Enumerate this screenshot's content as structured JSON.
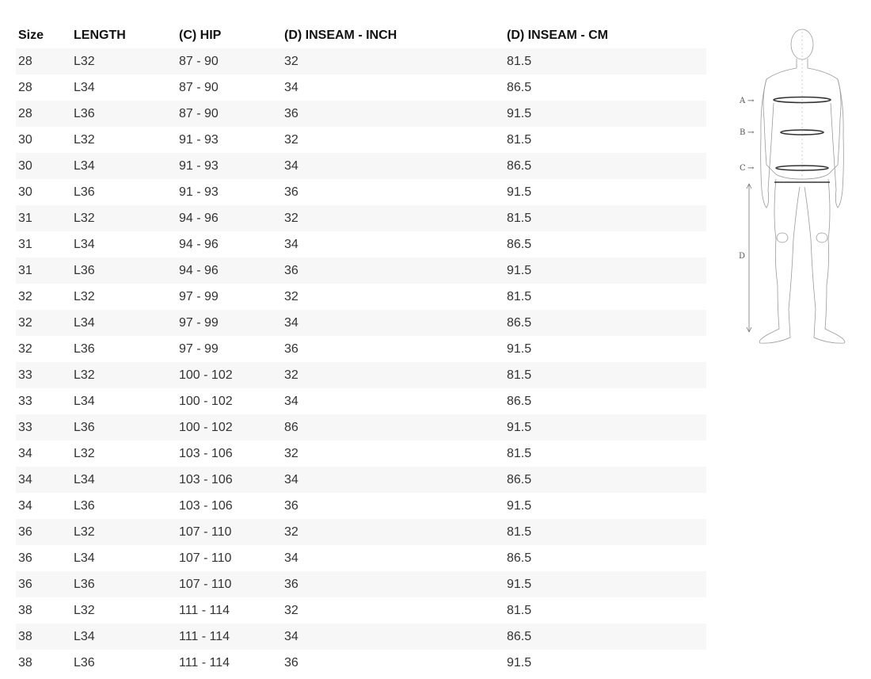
{
  "table": {
    "headers": [
      "Size",
      "LENGTH",
      "(C) HIP",
      "(D) INSEAM - INCH",
      "(D) INSEAM - CM"
    ],
    "rows": [
      [
        "28",
        "L32",
        "87 - 90",
        "32",
        "81.5"
      ],
      [
        "28",
        "L34",
        "87 - 90",
        "34",
        "86.5"
      ],
      [
        "28",
        "L36",
        "87 - 90",
        "36",
        "91.5"
      ],
      [
        "30",
        "L32",
        "91 - 93",
        "32",
        "81.5"
      ],
      [
        "30",
        "L34",
        "91 - 93",
        "34",
        "86.5"
      ],
      [
        "30",
        "L36",
        "91 - 93",
        "36",
        "91.5"
      ],
      [
        "31",
        "L32",
        "94 - 96",
        "32",
        "81.5"
      ],
      [
        "31",
        "L34",
        "94 - 96",
        "34",
        "86.5"
      ],
      [
        "31",
        "L36",
        "94 - 96",
        "36",
        "91.5"
      ],
      [
        "32",
        "L32",
        "97 - 99",
        "32",
        "81.5"
      ],
      [
        "32",
        "L34",
        "97 - 99",
        "34",
        "86.5"
      ],
      [
        "32",
        "L36",
        "97 - 99",
        "36",
        "91.5"
      ],
      [
        "33",
        "L32",
        "100 - 102",
        "32",
        "81.5"
      ],
      [
        "33",
        "L34",
        "100 - 102",
        "34",
        "86.5"
      ],
      [
        "33",
        "L36",
        "100 - 102",
        "86",
        "91.5"
      ],
      [
        "34",
        "L32",
        "103 - 106",
        "32",
        "81.5"
      ],
      [
        "34",
        "L34",
        "103 - 106",
        "34",
        "86.5"
      ],
      [
        "34",
        "L36",
        "103 - 106",
        "36",
        "91.5"
      ],
      [
        "36",
        "L32",
        "107 - 110",
        "32",
        "81.5"
      ],
      [
        "36",
        "L34",
        "107 - 110",
        "34",
        "86.5"
      ],
      [
        "36",
        "L36",
        "107 - 110",
        "36",
        "91.5"
      ],
      [
        "38",
        "L32",
        "111 - 114",
        "32",
        "81.5"
      ],
      [
        "38",
        "L34",
        "111 - 114",
        "34",
        "86.5"
      ],
      [
        "38",
        "L36",
        "111 - 114",
        "36",
        "91.5"
      ]
    ]
  },
  "figure": {
    "marker_a": "A",
    "marker_b": "B",
    "marker_c": "C",
    "marker_d": "D",
    "arrow": "→"
  },
  "colors": {
    "stripe": "#f7f7f7",
    "text": "#333333",
    "header_text": "#111111",
    "figure_line": "#9a9a9a"
  }
}
